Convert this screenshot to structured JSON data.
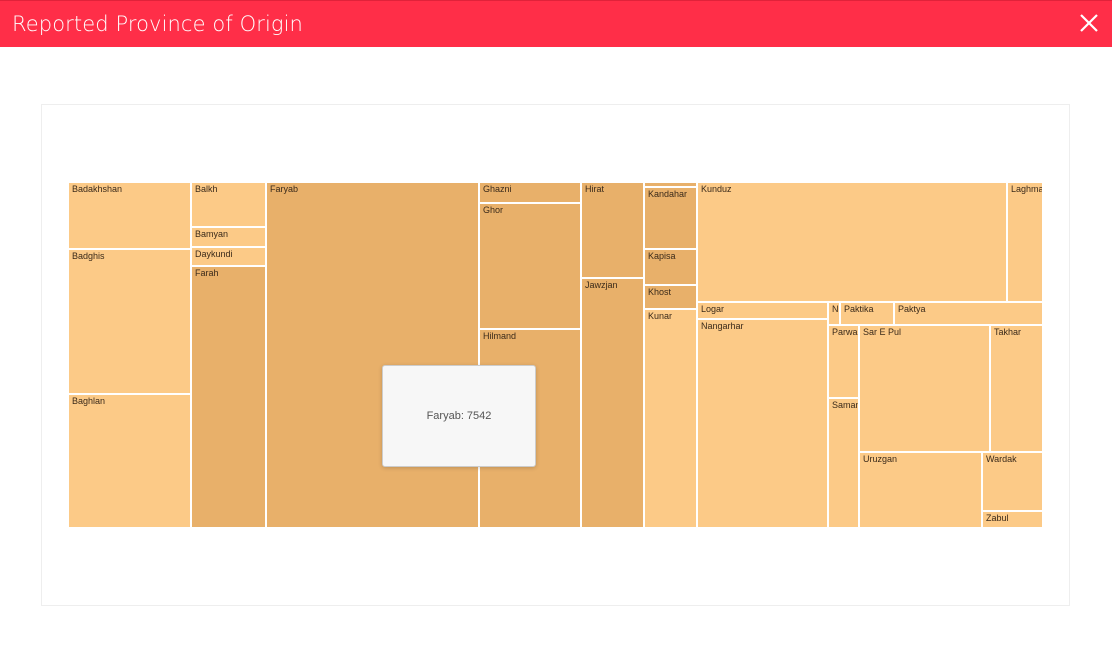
{
  "header": {
    "title": "Reported Province of Origin",
    "close_icon": "close-icon"
  },
  "colors": {
    "header_bg": "#ff2e48",
    "light": "#fcca87",
    "dark": "#e8b06a"
  },
  "tooltip": {
    "text": "Faryab: 7542"
  },
  "chart_data": {
    "type": "treemap",
    "title": "",
    "cells": [
      {
        "name": "Badakhshan",
        "shade": "light"
      },
      {
        "name": "Badghis",
        "shade": "light"
      },
      {
        "name": "Baghlan",
        "shade": "light"
      },
      {
        "name": "Balkh",
        "shade": "light"
      },
      {
        "name": "Bamyan",
        "shade": "light"
      },
      {
        "name": "Daykundi",
        "shade": "light"
      },
      {
        "name": "Farah",
        "shade": "dark"
      },
      {
        "name": "Faryab",
        "shade": "dark",
        "value": 7542
      },
      {
        "name": "Ghazni",
        "shade": "dark"
      },
      {
        "name": "Ghor",
        "shade": "dark"
      },
      {
        "name": "Hilmand",
        "shade": "dark"
      },
      {
        "name": "Hirat",
        "shade": "dark"
      },
      {
        "name": "Jawzjan",
        "shade": "dark"
      },
      {
        "name": "",
        "shade": "dark"
      },
      {
        "name": "Kandahar",
        "shade": "dark"
      },
      {
        "name": "Kapisa",
        "shade": "dark"
      },
      {
        "name": "Khost",
        "shade": "dark"
      },
      {
        "name": "Kunar",
        "shade": "light"
      },
      {
        "name": "Kunduz",
        "shade": "light"
      },
      {
        "name": "Laghman",
        "shade": "light"
      },
      {
        "name": "Logar",
        "shade": "light"
      },
      {
        "name": "",
        "shade": "light"
      },
      {
        "name": "Nangarhar",
        "shade": "light"
      },
      {
        "name": "N",
        "shade": "light"
      },
      {
        "name": "",
        "shade": "light"
      },
      {
        "name": "Paktika",
        "shade": "light"
      },
      {
        "name": "Paktya",
        "shade": "light"
      },
      {
        "name": "Parwan",
        "shade": "light"
      },
      {
        "name": "Samangan",
        "shade": "light"
      },
      {
        "name": "Sar E Pul",
        "shade": "light"
      },
      {
        "name": "Takhar",
        "shade": "light"
      },
      {
        "name": "Uruzgan",
        "shade": "light"
      },
      {
        "name": "Wardak",
        "shade": "light"
      },
      {
        "name": "Zabul",
        "shade": "light"
      }
    ]
  }
}
